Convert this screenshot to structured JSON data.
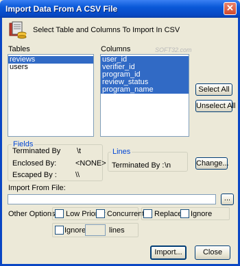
{
  "window": {
    "title": "Import Data From A CSV File",
    "close_glyph": "✕"
  },
  "header": {
    "instruction": "Select Table and Columns To Import In CSV"
  },
  "tables": {
    "label": "Tables",
    "items": [
      "reviews",
      "users"
    ],
    "selected_index": 0
  },
  "columns": {
    "label": "Columns",
    "items": [
      "user_id",
      "verifier_id",
      "program_id",
      "review_status",
      "program_name"
    ]
  },
  "buttons": {
    "select_all": "Select All",
    "unselect_all": "Unselect All",
    "change": "Change...",
    "browse": "...",
    "import": "Import...",
    "close": "Close"
  },
  "fields": {
    "legend": "Fields",
    "terminated_by_label": "Terminated By",
    "terminated_by_value": "\\t",
    "enclosed_by_label": "Enclosed By:",
    "enclosed_by_value": "<NONE>",
    "escaped_by_label": "Escaped By :",
    "escaped_by_value": "\\\\"
  },
  "lines": {
    "legend": "Lines",
    "terminated_by_label": "Terminated By :",
    "terminated_by_value": "\\n"
  },
  "import_file": {
    "label": "Import From File:",
    "value": ""
  },
  "options": {
    "label": "Other Options:",
    "low_priority": "Low Priority",
    "concurrent": "Concurrent",
    "replace": "Replace",
    "ignore": "Ignore",
    "ignore_lines_prefix": "Ignore",
    "ignore_lines_value": "",
    "ignore_lines_suffix": "lines"
  },
  "watermark": "SOFT32.com",
  "colors": {
    "title_bar": "#0a58d8",
    "selection": "#316ac5",
    "dialog_bg": "#ece9d8",
    "group_legend": "#0046d5"
  }
}
